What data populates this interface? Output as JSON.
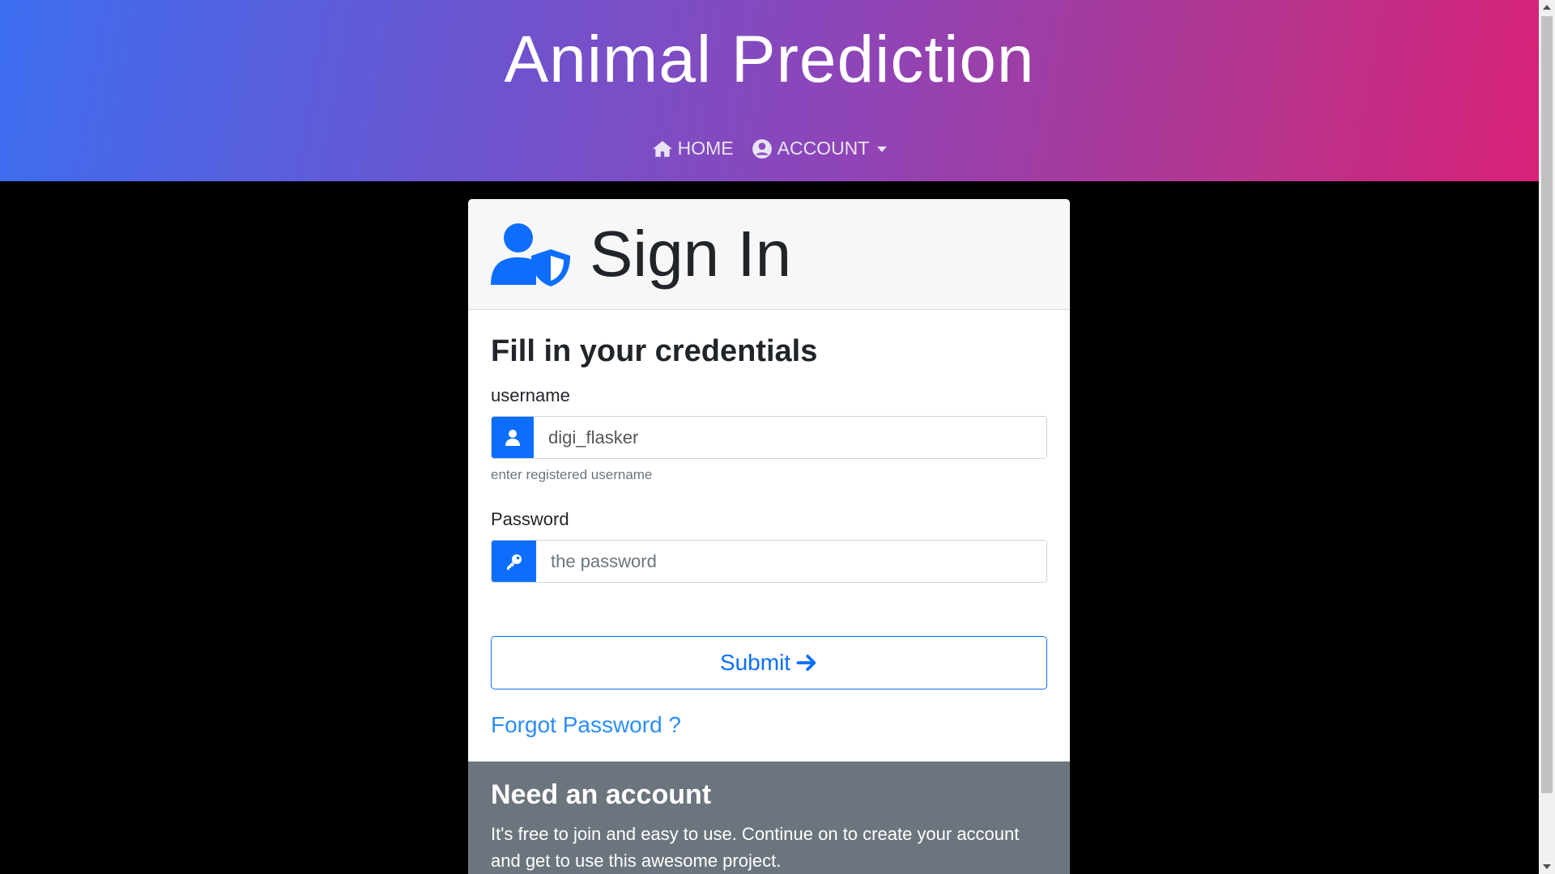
{
  "header": {
    "title": "Animal Prediction",
    "nav": [
      {
        "label": "HOME",
        "icon": "home-icon"
      },
      {
        "label": "ACCOUNT",
        "icon": "user-circle-icon"
      }
    ]
  },
  "card": {
    "title": "Sign In",
    "subtitle": "Fill in your credentials",
    "username": {
      "label": "username",
      "value": "digi_flasker",
      "placeholder": "",
      "help": "enter registered username"
    },
    "password": {
      "label": "Password",
      "value": "",
      "placeholder": "the password"
    },
    "submit_label": "Submit",
    "forgot_label": "Forgot Password ?",
    "footer": {
      "title": "Need an account",
      "text": "It's free to join and easy to use. Continue on to create your account and get to use this awesome project."
    }
  },
  "colors": {
    "primary": "#0d6efd",
    "footer_bg": "#6c757d",
    "header_gradient_start": "#3c6ef0",
    "header_gradient_end": "#d92178"
  }
}
